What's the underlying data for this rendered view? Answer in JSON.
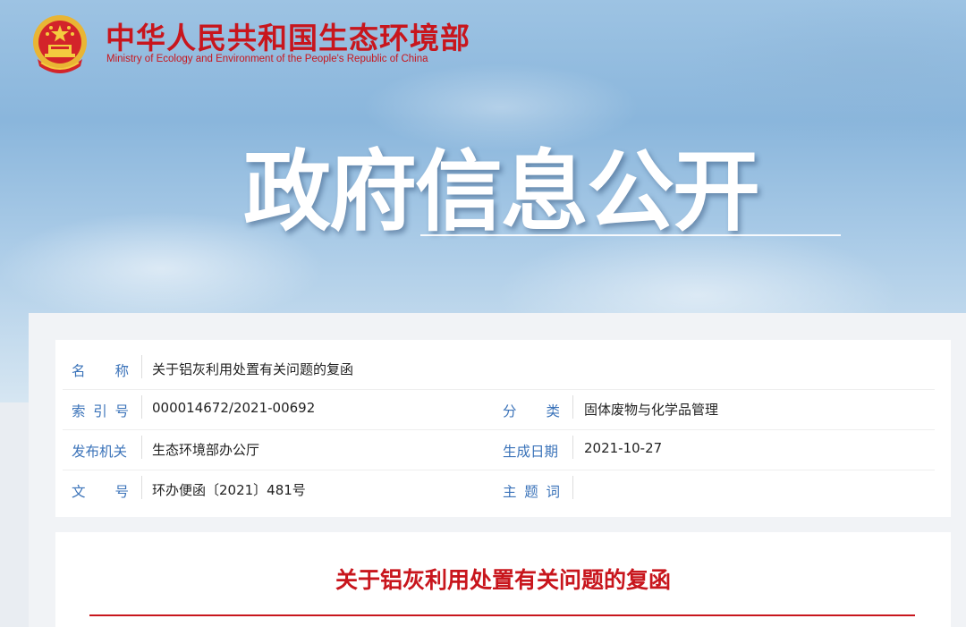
{
  "header": {
    "ministry_name_cn": "中华人民共和国生态环境部",
    "ministry_name_en": "Ministry of Ecology and Environment of the People's Republic of China",
    "section_title": "政府信息公开",
    "emblem_icon": "national-emblem-icon"
  },
  "metadata": {
    "name_label_chars": [
      "名",
      "称"
    ],
    "name_value": "关于铝灰利用处置有关问题的复函",
    "index_label_chars": [
      "索",
      "引",
      "号"
    ],
    "index_value": "000014672/2021-00692",
    "category_label_chars": [
      "分",
      "类"
    ],
    "category_value": "固体废物与化学品管理",
    "issuer_label_chars": [
      "发布机关"
    ],
    "issuer_value": "生态环境部办公厅",
    "date_label_chars": [
      "生成日期"
    ],
    "date_value": "2021-10-27",
    "docno_label_chars": [
      "文",
      "号"
    ],
    "docno_value": "环办便函〔2021〕481号",
    "keywords_label_chars": [
      "主",
      "题",
      "词"
    ],
    "keywords_value": ""
  },
  "document": {
    "title": "关于铝灰利用处置有关问题的复函"
  },
  "colors": {
    "brand_red": "#c8161d",
    "label_blue": "#3b73b9"
  }
}
